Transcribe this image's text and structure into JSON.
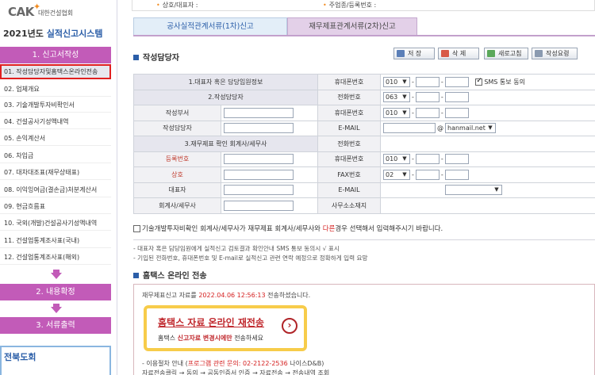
{
  "sidebar": {
    "logo_mark": "CAK",
    "logo_org": "대한건설협회",
    "title_year": "2021년도",
    "title_system": "실적신고시스템",
    "step1": "1. 신고서작성",
    "menu": [
      "01. 작성담당자및홈택스온라인전송",
      "02. 업체개요",
      "03. 기술개발투자비확인서",
      "04. 건설공사기성액내역",
      "05. 손익계산서",
      "06. 차입금",
      "07. 대차대조표(재무상태표)",
      "08. 이익잉여금(결손금)처분계산서",
      "09. 현금흐름표",
      "10. 국외(개발)건설공사기성액내역",
      "11. 건설업통계조사표(국내)",
      "12. 건설업통계조사표(해외)"
    ],
    "step2": "2. 내용확정",
    "step3": "3. 서류출력",
    "region": "전북도회"
  },
  "header": {
    "company_label": "상호/대표자 :",
    "reg_label": "주업종/등록번호 :"
  },
  "tabs": [
    {
      "label": "공사실적관계서류(1차)신고"
    },
    {
      "label": "재무제표관계서류(2차)신고"
    }
  ],
  "section_writer": {
    "title": "작성담당자",
    "buttons": {
      "save": "저  장",
      "delete": "삭  제",
      "refresh": "새로고침",
      "guide": "작성요령"
    }
  },
  "form": {
    "row1_label": "1.대표자 혹은 담당임원정보",
    "mobile_label": "휴대폰번호",
    "phone1_prefix": "010",
    "sms_label": "SMS 통보 동의",
    "row2_label": "2.작성담당자",
    "tel_label": "전화번호",
    "tel_prefix": "063",
    "dept_label": "작성부서",
    "mobile2_label": "휴대폰번호",
    "phone2_prefix": "010",
    "writer_label": "작성담당자",
    "email_label": "E-MAIL",
    "email_domain": "hanmail.net",
    "row3_label": "3.재무제표 확인 회계사/세무사",
    "tel3_label": "전화번호",
    "regno_label": "등록번호",
    "mobile3_label": "휴대폰번호",
    "phone3_prefix": "010",
    "company_label": "상호",
    "fax_label": "FAX번호",
    "fax_prefix": "02",
    "ceo_label": "대표자",
    "email3_label": "E-MAIL",
    "accountant_label": "회계사/세무사",
    "office_label": "사무소소재지"
  },
  "notice": {
    "part1": "기술개발투자비확인 회계사/세무사가 재무제표 회계사/세무사와 ",
    "red": "다른",
    "part2": "경우 선택해서 입력해주시기 바랍니다."
  },
  "bullets": [
    "- 대표자 혹은 담당임원에게 실적신고 검토결과 확인안내 SMS 통보 동의시 √ 표시",
    "- 기입된 전화번호, 휴대폰번호 및 E-mail로 실적신고 관련 연락 예정으로 정확하게 입력 요망"
  ],
  "hometax": {
    "title": "홈택스 온라인 전송",
    "line1_prefix": "재무제표신고 자료를 ",
    "line1_date": "2022.04.06 12:56:13",
    "line1_suffix": " 전송하셨습니다.",
    "resend_title": "홈택스 자료 온라인 재전송",
    "resend_sub_a": "홈택스 ",
    "resend_sub_b": "신고자료 변경시에만",
    "resend_sub_c": " 전송하세요",
    "resend_icon": "chevron-right-icon",
    "line2_a": "- 이용절차 안내 (",
    "line2_b": "프로그램 관련 문의: 02-2122-2536",
    "line2_c": " 나이스D&B)",
    "line3": "자료전송클릭 → 동의 → 공동인증서 인증 → 자료전송 → 전송내역 조회"
  },
  "colors": {
    "accent_purple": "#c25bb8",
    "link_blue": "#2b5ea8",
    "alert_red": "#d52020",
    "highlight_yellow": "#f7cc4a"
  }
}
